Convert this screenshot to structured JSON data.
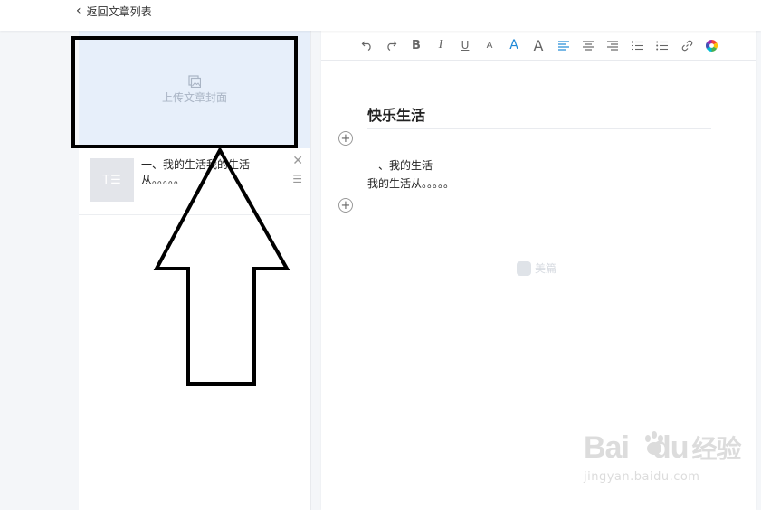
{
  "header": {
    "back_label": "返回文章列表"
  },
  "sidebar": {
    "cover_upload_label": "上传文章封面",
    "article": {
      "thumb_text": "T☰",
      "title_line1": "一、我的生活我的生活",
      "title_line2": "从。。。。。"
    }
  },
  "toolbar": {
    "items": [
      "undo",
      "redo",
      "bold",
      "italic",
      "underline",
      "font-size-small",
      "font-color",
      "font-size-large",
      "align-left",
      "align-center",
      "align-right",
      "ordered-list",
      "bullet-list",
      "link",
      "color-wheel"
    ],
    "bold_label": "B",
    "italic_label": "I",
    "underline_label": "U",
    "font_small_label": "A",
    "font_color_label": "A",
    "font_large_label": "A"
  },
  "editor": {
    "title": "快乐生活",
    "lines": [
      "一、我的生活",
      "我的生活从。。。。。"
    ],
    "watermark": "美篇"
  },
  "watermark_baidu": {
    "brand": "Bai",
    "brand_suffix": "du",
    "cn": "经验",
    "url": "jingyan.baidu.com"
  },
  "colors": {
    "cover_bg": "#e7effa",
    "accent_blue": "#1e88d6",
    "page_bg": "#f4f6f9"
  }
}
